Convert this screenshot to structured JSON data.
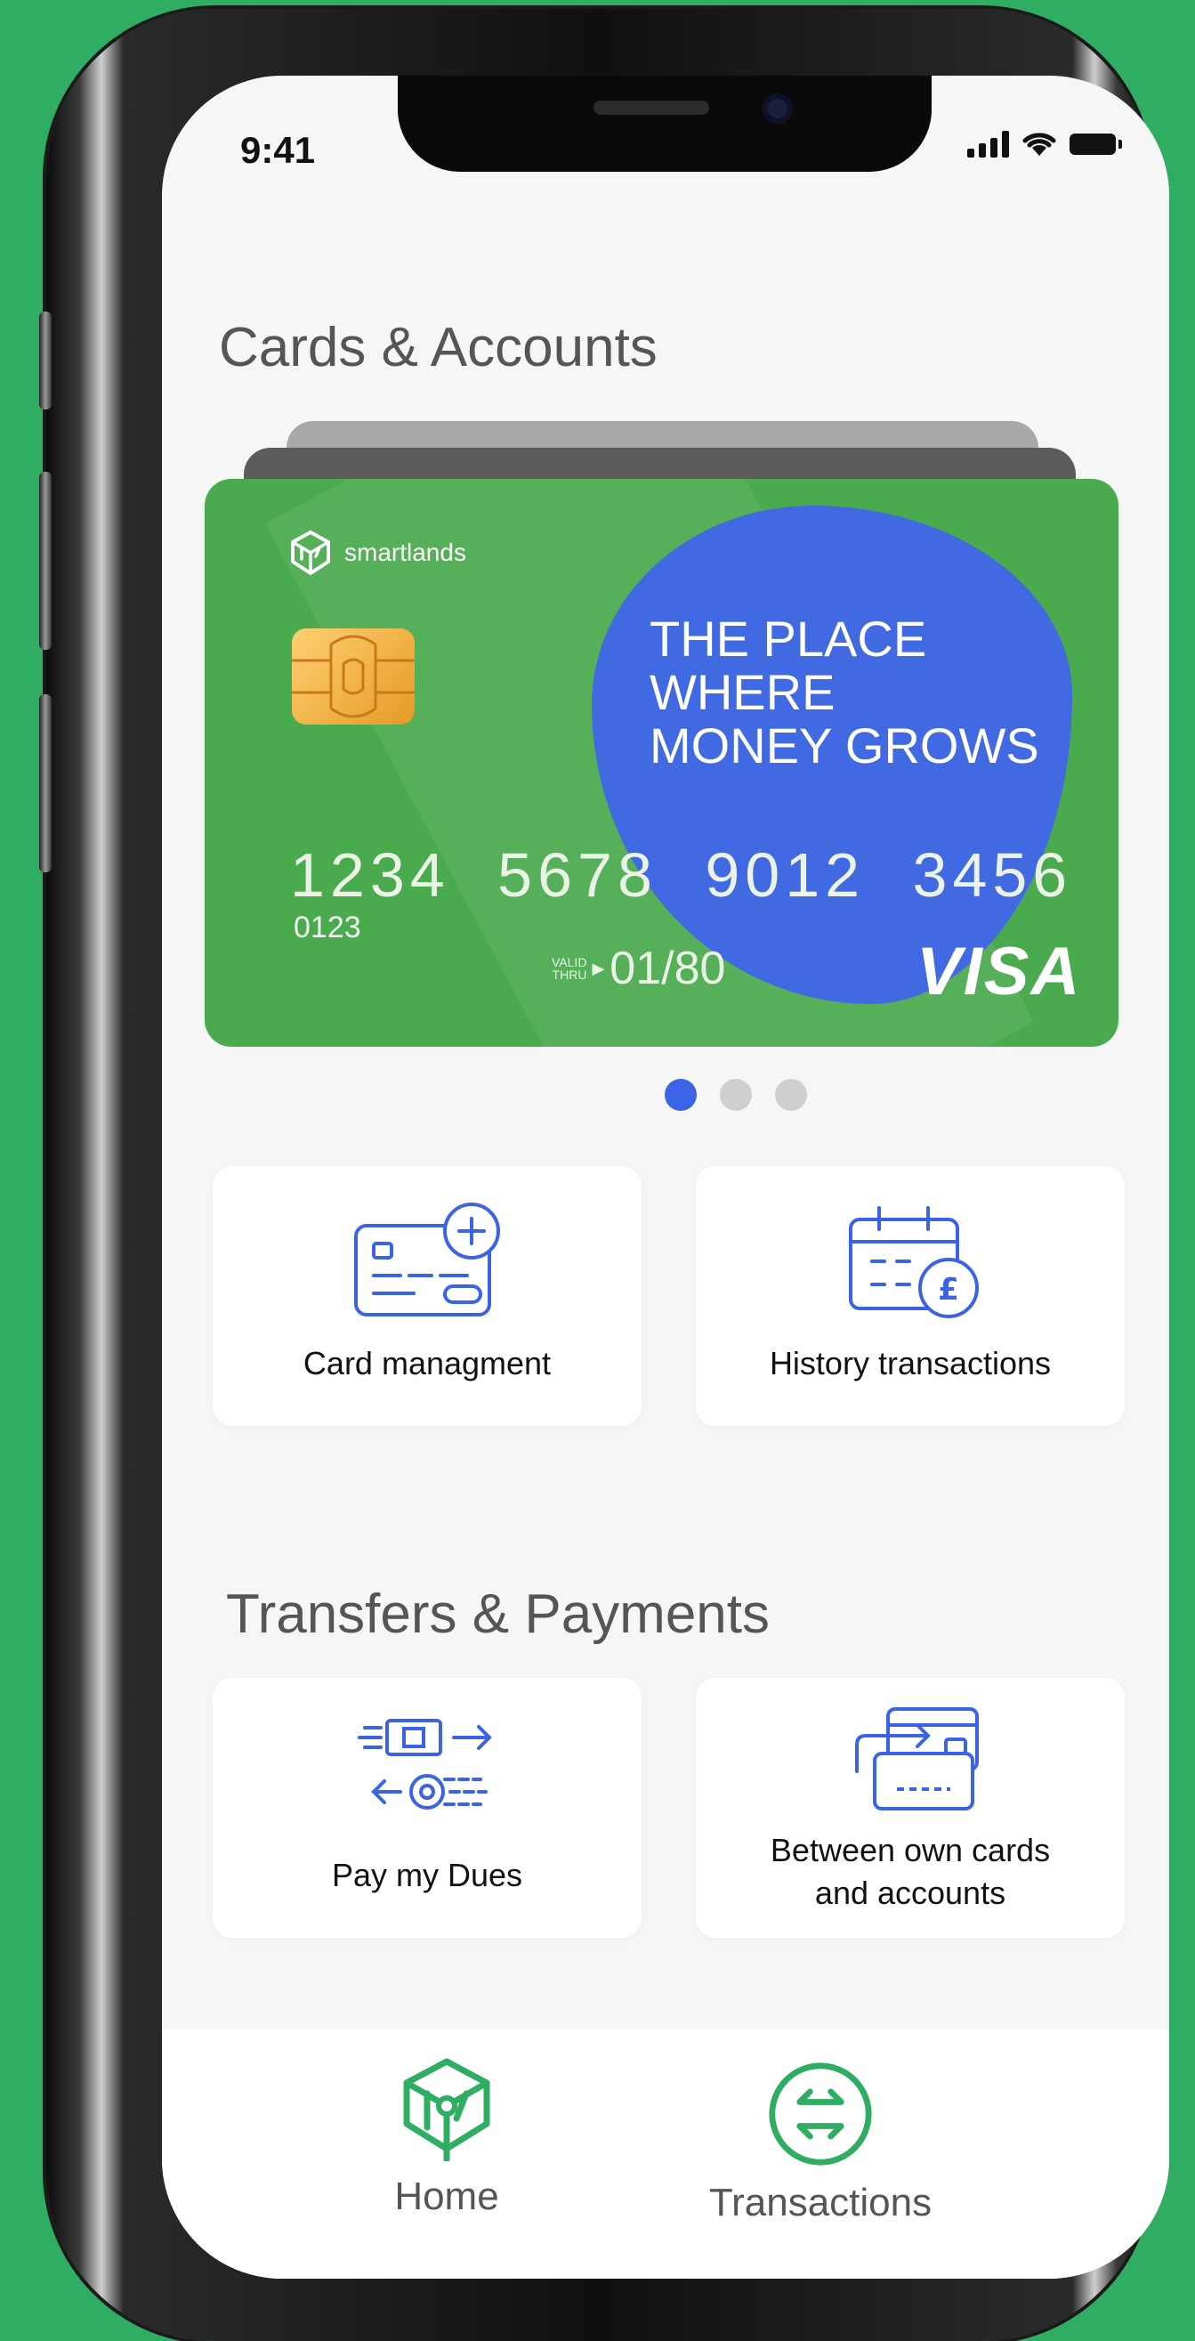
{
  "status_bar": {
    "time": "9:41"
  },
  "cards_section": {
    "title": "Cards & Accounts"
  },
  "card": {
    "brand": "smartlands",
    "slogan_line1": "THE PLACE",
    "slogan_line2": "WHERE",
    "slogan_line3": "MONEY GROWS",
    "number": "1234 5678 9012 3456",
    "small_number": "0123",
    "valid_label_1": "VALID",
    "valid_label_2": "THRU",
    "valid_thru": "01/80",
    "network": "VISA",
    "colors": {
      "card": "#4aab4e",
      "blob": "#4169e1"
    }
  },
  "carousel": {
    "count": 3,
    "active_index": 0
  },
  "card_actions": [
    {
      "label": "Card managment",
      "icon": "card-add-icon"
    },
    {
      "label": "History transactions",
      "icon": "calendar-pound-icon"
    }
  ],
  "transfers_section": {
    "title": "Transfers & Payments"
  },
  "transfer_actions": [
    {
      "label": "Pay my Dues",
      "icon": "money-exchange-icon"
    },
    {
      "label_line1": "Between own cards",
      "label_line2": "and accounts",
      "icon": "card-transfer-icon"
    }
  ],
  "bottom_nav": {
    "home": "Home",
    "transactions": "Transactions",
    "accent": "#2fae63"
  }
}
